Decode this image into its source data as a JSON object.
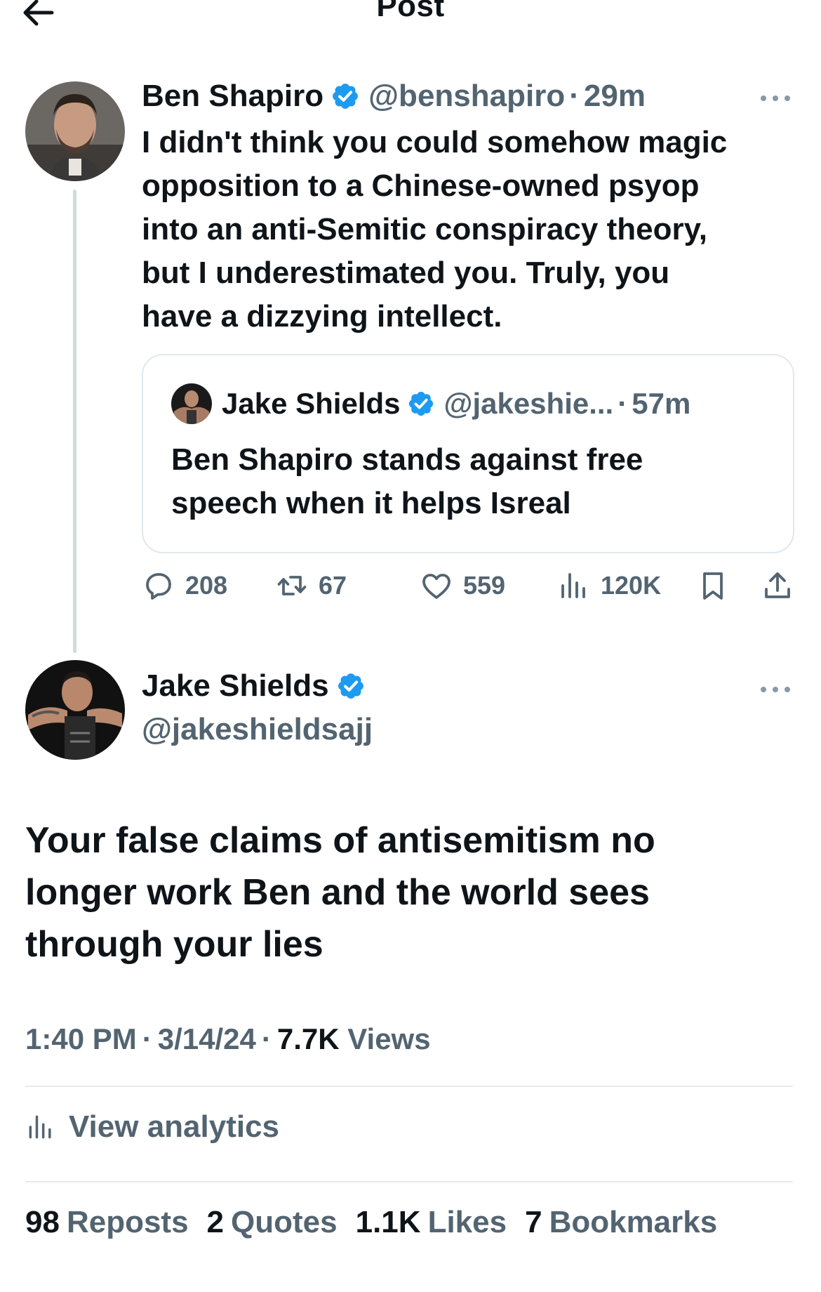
{
  "header": {
    "title": "Post",
    "back_icon": "arrow-left-icon"
  },
  "parent_tweet": {
    "author_name": "Ben Shapiro",
    "handle": "@benshapiro",
    "separator": "·",
    "time": "29m",
    "lines": [
      "I didn't think you could somehow magic",
      "opposition to a Chinese-owned psyop",
      "into an anti-Semitic conspiracy theory,",
      "but I underestimated you. Truly, you",
      "have a dizzying intellect."
    ],
    "quoted": {
      "author_name": "Jake Shields",
      "handle": "@jakeshie...",
      "separator": "·",
      "time": "57m",
      "lines": [
        "Ben Shapiro stands against free",
        "speech when it helps Isreal"
      ]
    },
    "actions": {
      "replies": "208",
      "reposts": "67",
      "likes": "559",
      "views": "120K"
    }
  },
  "main_tweet": {
    "author_name": "Jake Shields",
    "handle": "@jakeshieldsajj",
    "lines": [
      "Your false claims of antisemitism no",
      "longer work Ben and the world sees",
      "through your lies"
    ],
    "time": "1:40 PM",
    "date": "3/14/24",
    "separator": "·",
    "views_count": "7.7K",
    "views_label": "Views",
    "analytics_label": "View analytics",
    "stats": [
      {
        "num": "98",
        "label": "Reposts"
      },
      {
        "num": "2",
        "label": "Quotes"
      },
      {
        "num": "1.1K",
        "label": "Likes"
      },
      {
        "num": "7",
        "label": "Bookmarks"
      }
    ]
  },
  "colors": {
    "verified": "#1d9bf0",
    "text": "#0f1419",
    "muted": "#536471",
    "border": "#e1e8ed"
  }
}
